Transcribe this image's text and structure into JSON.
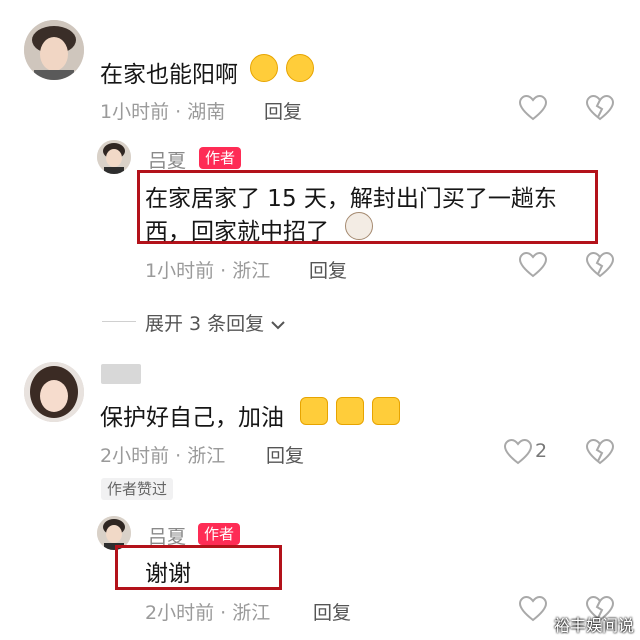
{
  "comment1": {
    "text": "在家也能阳啊",
    "time": "1小时前",
    "location": "湖南",
    "reply_label": "回复",
    "emojis": [
      "crying-laugh-emoji",
      "crying-laugh-emoji"
    ]
  },
  "reply1": {
    "name": "吕夏",
    "badge": "作者",
    "text_line1": "在家居家了 15 天，解封出门买了一趟东",
    "text_line2": "西，回家就中招了",
    "emoji": "cat-emoji",
    "time": "1小时前",
    "location": "浙江",
    "reply_label": "回复"
  },
  "expand": {
    "label": "展开 3 条回复"
  },
  "comment2": {
    "text": "保护好自己，加油",
    "emojis": [
      "finger-heart-emoji",
      "finger-heart-emoji",
      "finger-heart-emoji"
    ],
    "time": "2小时前",
    "location": "浙江",
    "reply_label": "回复",
    "like_count": "2",
    "author_liked": "作者赞过"
  },
  "reply2": {
    "name": "吕夏",
    "badge": "作者",
    "text": "谢谢",
    "time": "2小时前",
    "location": "浙江",
    "reply_label": "回复"
  },
  "watermark": "裕丰娱间说",
  "colors": {
    "author_badge": "#fe2c55",
    "highlight_box": "#b3121a"
  }
}
